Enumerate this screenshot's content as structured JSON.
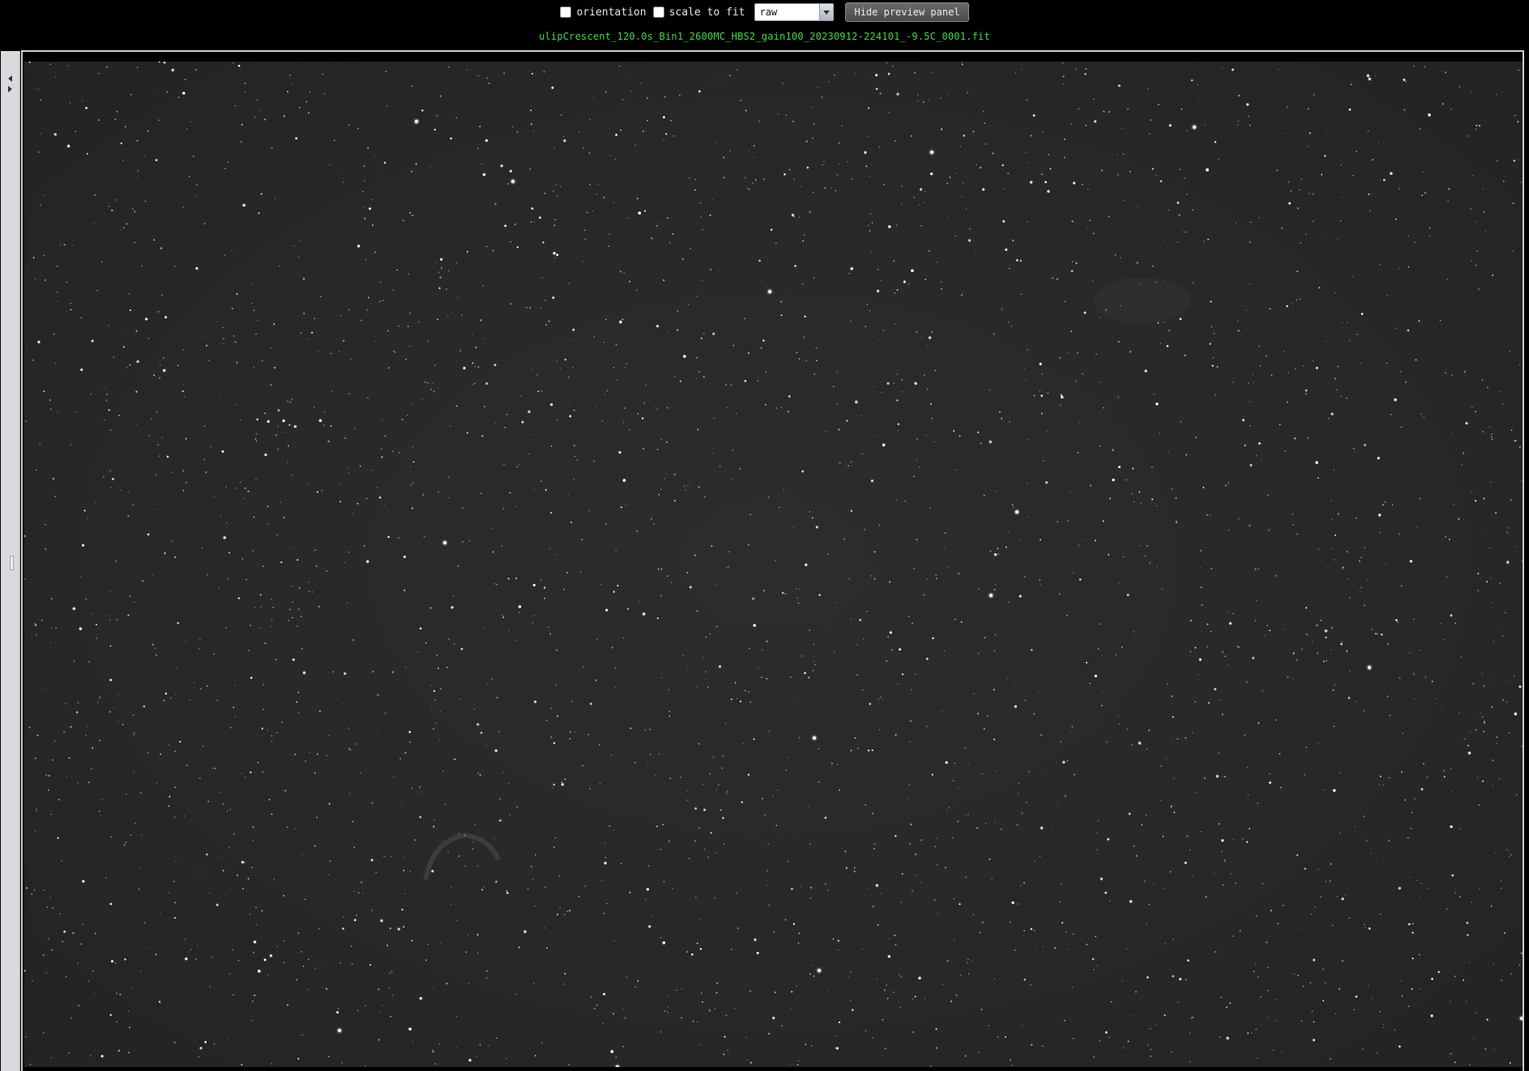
{
  "toolbar": {
    "orientation_label": "orientation",
    "orientation_checked": false,
    "scale_to_fit_label": "scale to fit",
    "scale_to_fit_checked": false,
    "stretch_select": {
      "selected": "raw"
    },
    "hide_preview_label": "Hide preview panel"
  },
  "preview": {
    "filename": "ulipCrescent_120.0s_Bin1_2600MC_HBS2_gain100_20230912-224101_-9.5C_0001.fit"
  },
  "colors": {
    "background": "#000000",
    "filename_text": "#43d843",
    "image_sky": "#2a2a2a",
    "side_bar": "#d9dadd"
  },
  "icons": {
    "side_collapse_left": "chevron-left-icon",
    "side_collapse_right": "chevron-right-icon",
    "select_dropdown": "chevron-down-icon"
  }
}
